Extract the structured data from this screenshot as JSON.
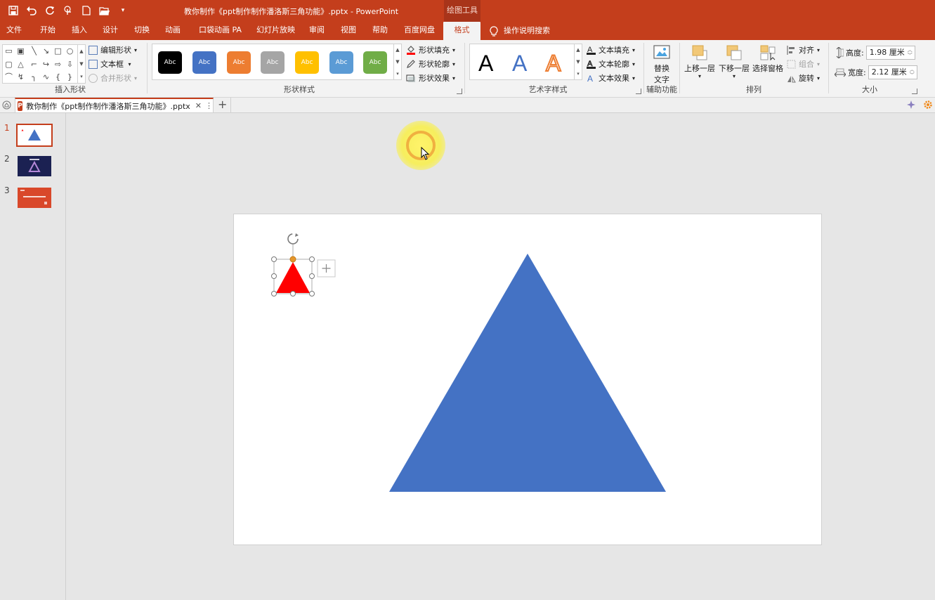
{
  "window": {
    "title": "教你制作《ppt制作制作潘洛斯三角功能》.pptx  -  PowerPoint",
    "context_tool": "绘图工具"
  },
  "quick_access": {
    "icons": [
      "save-icon",
      "undo-icon",
      "redo-icon",
      "touch-mode-icon",
      "new-icon",
      "open-icon",
      "customize-icon"
    ]
  },
  "tabs": [
    {
      "label": "文件"
    },
    {
      "label": "开始"
    },
    {
      "label": "插入"
    },
    {
      "label": "设计"
    },
    {
      "label": "切换"
    },
    {
      "label": "动画"
    },
    {
      "label": "口袋动画 PA"
    },
    {
      "label": "幻灯片放映"
    },
    {
      "label": "审阅"
    },
    {
      "label": "视图"
    },
    {
      "label": "帮助"
    },
    {
      "label": "百度网盘"
    },
    {
      "label": "格式"
    }
  ],
  "tell_me": "操作说明搜索",
  "ribbon": {
    "insert_shapes": {
      "label": "插入形状",
      "edit_shape": "编辑形状",
      "text_box": "文本框",
      "merge_shapes": "合并形状",
      "shapes": [
        "▭",
        "▣",
        "╲",
        "↘",
        "□",
        "○",
        "▢",
        "△",
        "⌐",
        "↪",
        "⇨",
        "⇩",
        "⌒",
        "↯",
        "╮",
        "∿",
        "{",
        "}"
      ]
    },
    "shape_styles": {
      "label": "形状样式",
      "swatch_text": "Abc",
      "swatches": [
        "#000000",
        "#4472c4",
        "#ed7d31",
        "#a5a5a5",
        "#ffc000",
        "#5b9bd5",
        "#70ad47"
      ],
      "fill": "形状填充",
      "outline": "形状轮廓",
      "effects": "形状效果"
    },
    "wordart": {
      "label": "艺术字样式",
      "letter": "A",
      "text_fill": "文本填充",
      "text_outline": "文本轮廓",
      "text_effects": "文本效果"
    },
    "accessibility": {
      "label": "辅助功能",
      "alt_text_line1": "替换",
      "alt_text_line2": "文字"
    },
    "arrange": {
      "label": "排列",
      "bring_forward": "上移一层",
      "send_backward": "下移一层",
      "selection_pane": "选择窗格",
      "align": "对齐",
      "group": "组合",
      "rotate": "旋转"
    },
    "size": {
      "label": "大小",
      "height_label": "高度:",
      "height_value": "1.98 厘米",
      "width_label": "宽度:",
      "width_value": "2.12 厘米"
    }
  },
  "document_tab": {
    "name": "教你制作《ppt制作制作潘洛斯三角功能》.pptx",
    "badge": "P"
  },
  "slides": [
    {
      "number": "1",
      "selected": true
    },
    {
      "number": "2",
      "selected": false
    },
    {
      "number": "3",
      "selected": false
    }
  ],
  "colors": {
    "accent": "#c43e1c",
    "blue_triangle": "#4472c4",
    "red_triangle": "#ff0000"
  }
}
